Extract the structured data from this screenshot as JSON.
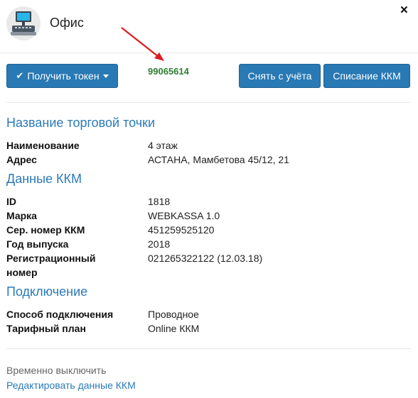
{
  "header": {
    "title": "Офис",
    "close_glyph": "×"
  },
  "toolbar": {
    "token_button": "Получить токен",
    "token_value": "99065614",
    "deregister_button": "Снять с учёта",
    "writeoff_button": "Списание ККМ"
  },
  "sections": {
    "outlet": {
      "title": "Название торговой точки",
      "rows": [
        {
          "label": "Наименование",
          "value": "4 этаж"
        },
        {
          "label": "Адрес",
          "value": "АСТАНА, Мамбетова 45/12, 21"
        }
      ]
    },
    "kkm": {
      "title": "Данные ККМ",
      "rows": [
        {
          "label": "ID",
          "value": "1818"
        },
        {
          "label": "Марка",
          "value": "WEBKASSA 1.0"
        },
        {
          "label": "Сер. номер ККМ",
          "value": "451259525120"
        },
        {
          "label": "Год выпуска",
          "value": "2018"
        },
        {
          "label": "Регистрационный номер",
          "value": "021265322122 (12.03.18)"
        }
      ]
    },
    "connection": {
      "title": "Подключение",
      "rows": [
        {
          "label": "Способ подключения",
          "value": "Проводное"
        },
        {
          "label": "Тарифный план",
          "value": "Online ККМ"
        }
      ]
    }
  },
  "footer": {
    "disable_text": "Временно выключить",
    "edit_link": "Редактировать данные ККМ"
  },
  "icons": {
    "avatar": "pos-terminal-icon",
    "token": "check-icon",
    "annotation": "red-arrow-icon"
  },
  "colors": {
    "primary": "#2879b4",
    "section_title": "#2a7ab9",
    "token_value": "#2e7d32",
    "arrow": "#e0191f"
  }
}
